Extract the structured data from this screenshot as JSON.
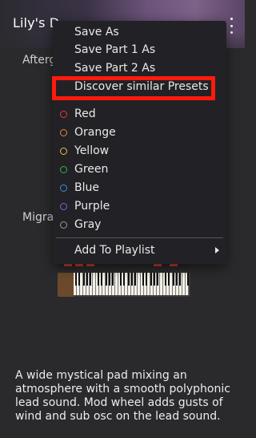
{
  "header": {
    "title": "Lily's D",
    "more_icon": "more-vertical-icon"
  },
  "background": {
    "after_label": "Afterg",
    "migra_label": "Migra",
    "instrument_image": "synthesizer-keyboard-image",
    "description": "A wide mystical pad mixing an atmosphere with a smooth polyphonic lead sound. Mod wheel adds gusts of wind and sub osc on the lead sound."
  },
  "menu": {
    "items": [
      {
        "label": "Save As"
      },
      {
        "label": "Save Part 1 As"
      },
      {
        "label": "Save Part 2 As"
      },
      {
        "label": "Discover similar Presets"
      }
    ],
    "colors": [
      {
        "label": "Red",
        "color": "#e03b3b"
      },
      {
        "label": "Orange",
        "color": "#e8872c"
      },
      {
        "label": "Yellow",
        "color": "#e8c33a"
      },
      {
        "label": "Green",
        "color": "#3eb04a"
      },
      {
        "label": "Blue",
        "color": "#3d8fd6"
      },
      {
        "label": "Purple",
        "color": "#9b55d6"
      },
      {
        "label": "Gray",
        "color": "#9a9a9a"
      }
    ],
    "add_to_playlist": "Add To Playlist",
    "submenu_icon": "chevron-right-icon"
  },
  "annotation": {
    "highlight_color": "#ff1a0d"
  }
}
